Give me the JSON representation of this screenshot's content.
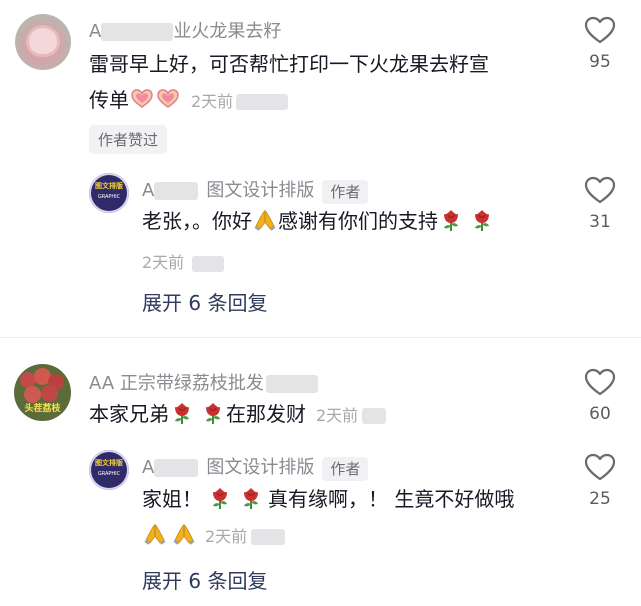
{
  "comment1": {
    "author": "A",
    "author_tail": "业火龙果去籽",
    "text_line1": "雷哥早上好，可否帮忙打印一下火龙果去籽宣",
    "text_line2": "传单",
    "time": "2天前",
    "badge": "作者赞过",
    "likes": "95",
    "reply": {
      "author": "A",
      "author_tail": "图文设计排版",
      "author_tag": "作者",
      "text_before": "老张，。你好",
      "text_after": "感谢有你们的支持",
      "time": "2天前",
      "likes": "31",
      "avatar_text_top": "图文排版",
      "avatar_text_bottom": "GRAPHIC"
    },
    "expand_label": "展开 6 条回复"
  },
  "comment2": {
    "author": "AA 正宗带绿荔枝批发",
    "text_before": "本家兄弟",
    "text_after": "在那发财",
    "time": "2天前",
    "likes": "60",
    "avatar_text": "头茬荔枝",
    "reply": {
      "author": "A",
      "author_tail": "图文设计排版",
      "author_tag": "作者",
      "text_before": "家姐！",
      "text_after": "真有缘啊，！ 生竟不好做哦",
      "time": "2天前",
      "likes": "25",
      "avatar_text_top": "图文排版",
      "avatar_text_bottom": "GRAPHIC"
    },
    "expand_label": "展开 6 条回复"
  },
  "icons": {
    "like": "heart-outline-icon",
    "heart_emoji": "heart-hands-emoji",
    "pray": "folded-hands-emoji",
    "rose": "rose-emoji"
  },
  "colors": {
    "secondary_text": "#8a8b91",
    "primary_text": "#161823",
    "expand_text": "#2f3a5c",
    "rose": "#c8312f",
    "pray": "#f2b01e"
  }
}
